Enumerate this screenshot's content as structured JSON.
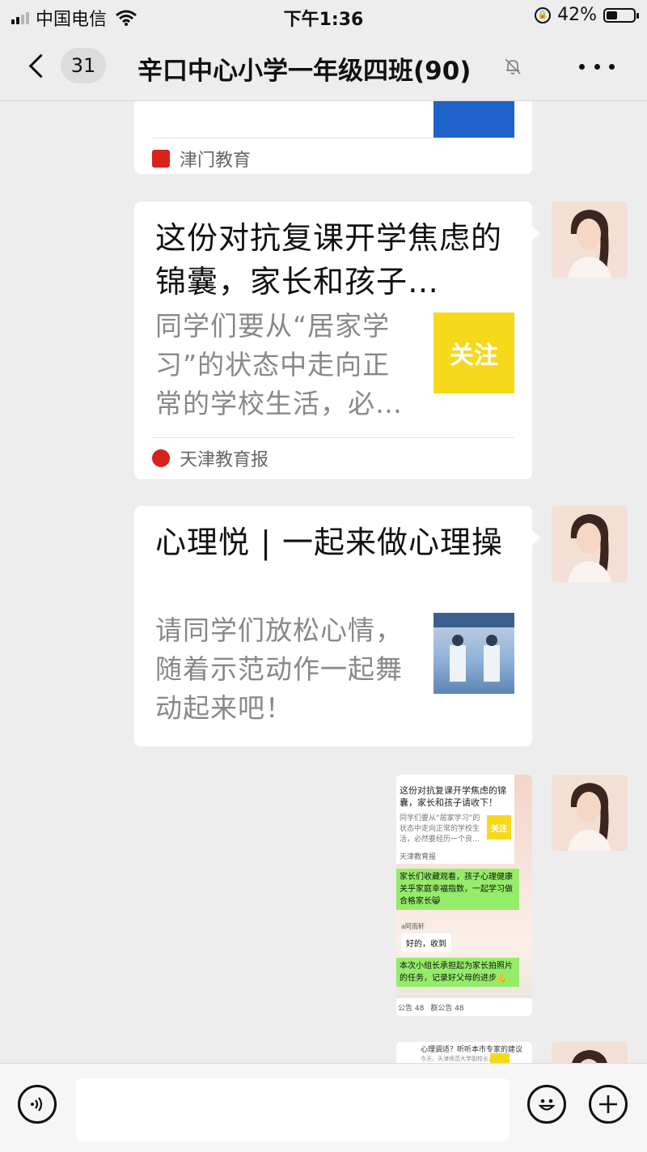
{
  "status_bar": {
    "carrier": "中国电信",
    "time": "下午1:36",
    "battery_percent": "42%",
    "battery_level": 0.42
  },
  "nav": {
    "unread_count": "31",
    "title": "辛口中心小学一年级四班(90)"
  },
  "messages": [
    {
      "type": "article-card",
      "source": "津门教育",
      "source_color": "#d9221c",
      "thumb_color": "#1f62c9"
    },
    {
      "type": "article-card",
      "title": "这份对抗复课开学焦虑的锦囊，家长和孩子…",
      "description": "同学们要从“居家学习”的状态中走向正常的学校生活，必…",
      "thumb_text": "关注",
      "source": "天津教育报",
      "source_color": "#d9221c"
    },
    {
      "type": "article-card",
      "title": "心理悦 | 一起来做心理操",
      "description": "请同学们放松心情，随着示范动作一起舞动起来吧！"
    },
    {
      "type": "image",
      "embedded": {
        "card_title": "这份对抗复课开学焦虑的锦囊，家长和孩子请收下！",
        "card_desc": "同学们要从“居家学习”的状态中走向正常的学校生活，必然要经历一个良...",
        "card_thumb": "关注",
        "card_source": "天津教育报",
        "green1": "家长们收藏观看，孩子心理健康关乎家庭幸福指数，一起学习做合格家长😸",
        "name": "a阿雨轩",
        "white": "好的，收到",
        "green2": "本次小组长承担起为家长拍照片的任务，记录好父母的进步💪",
        "bottom_left": "公告 48",
        "bottom_right": "群公告 48"
      }
    },
    {
      "type": "image",
      "embedded": {
        "title": "心理调适？听听本市专家的建议",
        "desc": "今天，天津师范大学副校长，心理学部部长白学军教授将围..."
      }
    }
  ],
  "input": {
    "placeholder": ""
  }
}
